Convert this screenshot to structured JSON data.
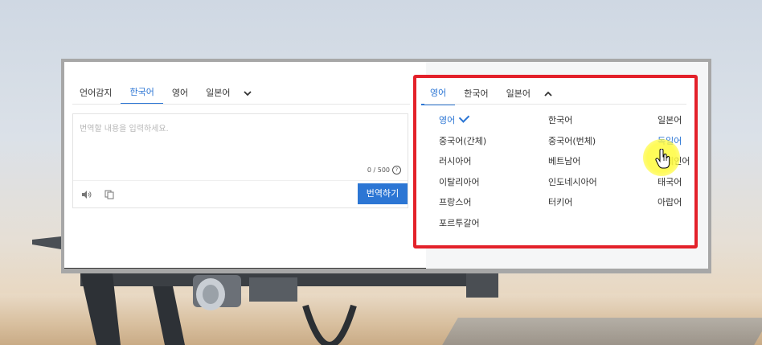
{
  "source_tabs": {
    "items": [
      "언어감지",
      "한국어",
      "영어",
      "일본어"
    ],
    "active_index": 1
  },
  "input": {
    "placeholder": "번역할 내용을 입력하세요.",
    "counter": "0 / 500",
    "translate_label": "번역하기"
  },
  "target_tabs": {
    "items": [
      "영어",
      "한국어",
      "일본어"
    ],
    "active_index": 0
  },
  "languages": {
    "col1": [
      "영어",
      "중국어(간체)",
      "러시아어",
      "이탈리아어",
      "프랑스어",
      "포르투갈어"
    ],
    "col2": [
      "한국어",
      "중국어(번체)",
      "베트남어",
      "인도네시아어",
      "터키어"
    ],
    "col3": [
      "일본어",
      "독일어",
      "스페인어",
      "태국어",
      "아랍어"
    ],
    "selected": "영어",
    "hovered": "독일어"
  },
  "colors": {
    "accent": "#2c76d4",
    "highlight_border": "#e3212a",
    "cursor_halo": "#fff74a"
  },
  "icons": [
    "chevron-down-icon",
    "chevron-up-icon",
    "speaker-icon",
    "copy-icon",
    "help-icon",
    "check-icon",
    "hand-cursor-icon"
  ]
}
